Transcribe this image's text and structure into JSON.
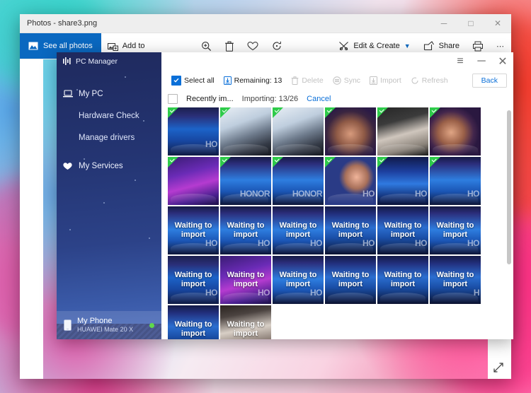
{
  "photos_app": {
    "title": "Photos - share3.png",
    "titlebar_buttons": [
      {
        "name": "minimize",
        "glyph": "─"
      },
      {
        "name": "maximize",
        "glyph": "□"
      },
      {
        "name": "close",
        "glyph": "✕"
      }
    ],
    "toolbar": {
      "see_all_photos": "See all photos",
      "add_to": "Add to",
      "zoom_icon": "magnifier-plus-icon",
      "delete_icon": "trash-icon",
      "favorite_icon": "heart-icon",
      "rotate_icon": "rotate-icon",
      "edit_create": "Edit & Create",
      "edit_create_chevron": "⌄",
      "share": "Share",
      "print_icon": "printer-icon",
      "more_icon": "ellipsis-icon"
    },
    "expand_icon": "expand-diagonal-icon"
  },
  "pc_manager": {
    "brand": "PC Manager",
    "brand_icon": "pc-manager-logo-icon",
    "titlebar_buttons": [
      {
        "name": "menu",
        "glyph": "≡"
      },
      {
        "name": "minimize",
        "glyph": "─"
      },
      {
        "name": "close",
        "glyph": "✕"
      }
    ],
    "sidebar": {
      "items": [
        {
          "label": "My PC",
          "icon": "laptop-icon",
          "sub": false
        },
        {
          "label": "Hardware Check",
          "icon": "",
          "sub": true
        },
        {
          "label": "Manage drivers",
          "icon": "",
          "sub": true
        },
        {
          "label": "My Services",
          "icon": "heart-icon",
          "sub": false
        }
      ],
      "device": {
        "name": "My Phone",
        "model": "HUAWEI Mate 20 X",
        "icon": "phone-icon",
        "status": "connected",
        "status_color": "#5fd94a"
      }
    },
    "action_bar": {
      "select_all": "Select all",
      "remaining": "Remaining: 13",
      "remaining_icon": "import-icon",
      "delete": "Delete",
      "delete_icon": "trash-icon",
      "sync": "Sync",
      "sync_icon": "sync-icon",
      "import": "Import",
      "import_icon": "import-icon",
      "refresh": "Refresh",
      "refresh_icon": "refresh-icon",
      "back": "Back",
      "disabled_items": [
        "Delete",
        "Sync",
        "Import",
        "Refresh"
      ]
    },
    "group_row": {
      "group_name": "Recently im...",
      "import_status": "Importing: 13/26",
      "cancel": "Cancel"
    },
    "grid": {
      "wait_label": "Waiting to import",
      "columns": 6,
      "tiles": [
        {
          "art": "a-stage",
          "imported": true,
          "honor": "HO"
        },
        {
          "art": "a-band",
          "imported": true,
          "honor": ""
        },
        {
          "art": "a-band",
          "imported": true,
          "honor": ""
        },
        {
          "art": "a-hand",
          "imported": true,
          "honor": ""
        },
        {
          "art": "a-dark",
          "imported": true,
          "honor": ""
        },
        {
          "art": "a-hand2",
          "imported": true,
          "honor": ""
        },
        {
          "art": "a-purple",
          "imported": true,
          "honor": ""
        },
        {
          "art": "a-stage2",
          "imported": true,
          "honor": "HONOR"
        },
        {
          "art": "a-stage2",
          "imported": true,
          "honor": "HONOR"
        },
        {
          "art": "a-face",
          "imported": true,
          "honor": "HO"
        },
        {
          "art": "a-512",
          "imported": true,
          "honor": "HO"
        },
        {
          "art": "a-stage2",
          "imported": true,
          "honor": "HO"
        },
        {
          "art": "a-stage2",
          "imported": false,
          "honor": "HO"
        },
        {
          "art": "a-stage2",
          "imported": false,
          "honor": "HO"
        },
        {
          "art": "a-stage2",
          "imported": false,
          "honor": "HO"
        },
        {
          "art": "a-people",
          "imported": false,
          "honor": "HO"
        },
        {
          "art": "a-people",
          "imported": false,
          "honor": "HO"
        },
        {
          "art": "a-stage2",
          "imported": false,
          "honor": "HO"
        },
        {
          "art": "a-stage",
          "imported": false,
          "honor": "HO"
        },
        {
          "art": "a-purple",
          "imported": false,
          "honor": "HO"
        },
        {
          "art": "a-stage2",
          "imported": false,
          "honor": "HO"
        },
        {
          "art": "a-people",
          "imported": false,
          "honor": ""
        },
        {
          "art": "a-people",
          "imported": false,
          "honor": ""
        },
        {
          "art": "a-people",
          "imported": false,
          "honor": "H"
        },
        {
          "art": "a-people",
          "imported": false,
          "honor": ""
        },
        {
          "art": "a-webcam",
          "imported": false,
          "honor": ""
        }
      ]
    }
  }
}
